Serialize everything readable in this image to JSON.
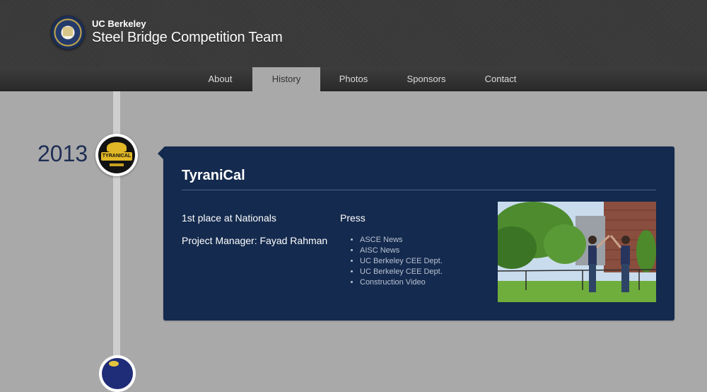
{
  "header": {
    "subtitle": "UC Berkeley",
    "title": "Steel Bridge Competition Team",
    "seal_icon": "uc-berkeley-seal"
  },
  "nav": {
    "items": [
      {
        "label": "About",
        "active": false
      },
      {
        "label": "History",
        "active": true
      },
      {
        "label": "Photos",
        "active": false
      },
      {
        "label": "Sponsors",
        "active": false
      },
      {
        "label": "Contact",
        "active": false
      }
    ]
  },
  "timeline": {
    "entries": [
      {
        "year": "2013",
        "badge_icon": "tyranical-logo",
        "badge_text": "TYRANICAL",
        "title": "TyraniCal",
        "details": [
          "1st place at Nationals",
          "Project Manager: Fayad Rahman"
        ],
        "press_heading": "Press",
        "press_links": [
          "ASCE News",
          "AISC News",
          "UC Berkeley CEE Dept.",
          "UC Berkeley CEE Dept.",
          "Construction Video"
        ],
        "photo_icon": "team-members-photo"
      }
    ]
  },
  "colors": {
    "page_bg": "#a9a9a9",
    "header_bg": "#3a3a3a",
    "card_bg": "#142a4e",
    "year_color": "#1e2e55",
    "timeline_line": "#cfcfcf"
  }
}
